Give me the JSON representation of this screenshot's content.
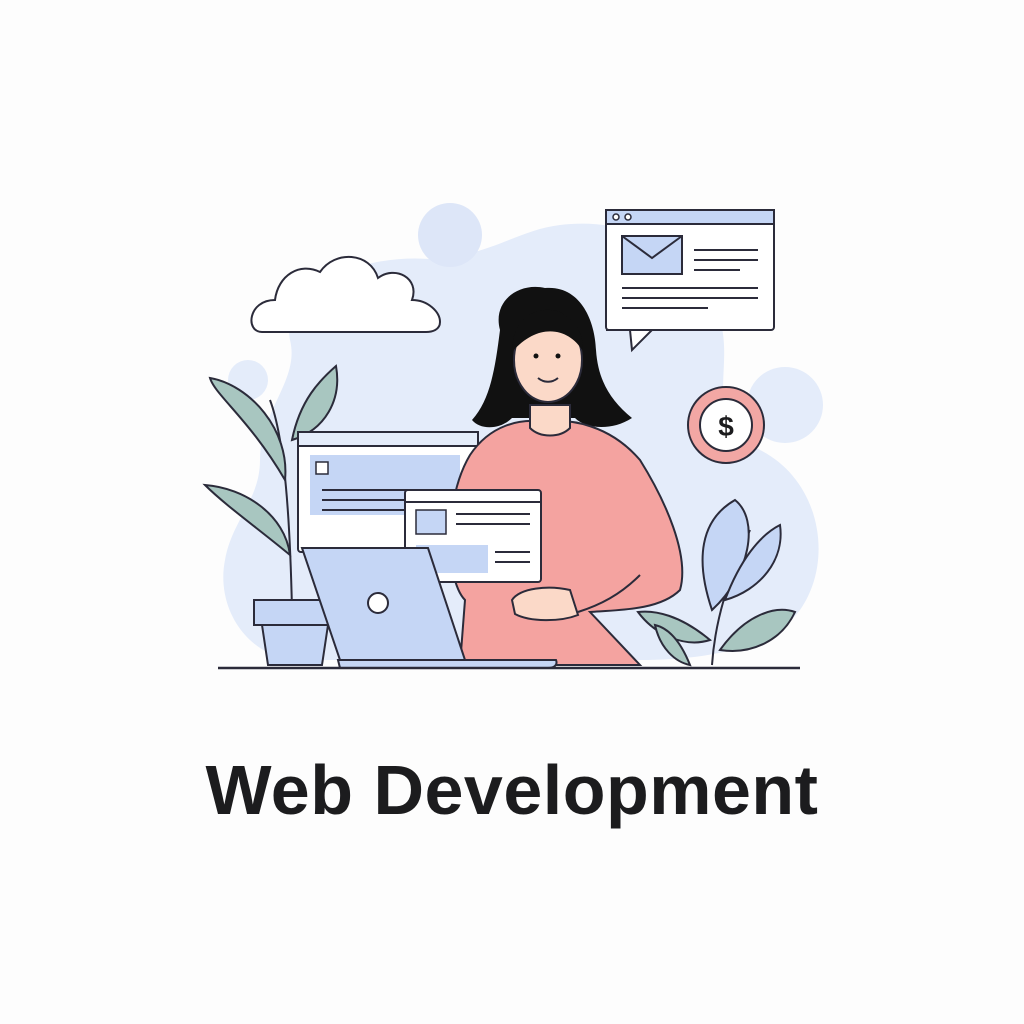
{
  "title": "Web Development",
  "icons": {
    "currency": "dollar-coin-icon",
    "mail": "envelope-icon",
    "cloud": "cloud-icon"
  },
  "dollar_symbol": "$",
  "colors": {
    "blob": "#e4ecfa",
    "blue_fill": "#c5d6f5",
    "shirt": "#f4a3a0",
    "skin": "#fbd9c8",
    "hair": "#111111",
    "leaf": "#a8c6c0",
    "coin_ring": "#f2a7a4",
    "outline": "#2b2b3a"
  }
}
